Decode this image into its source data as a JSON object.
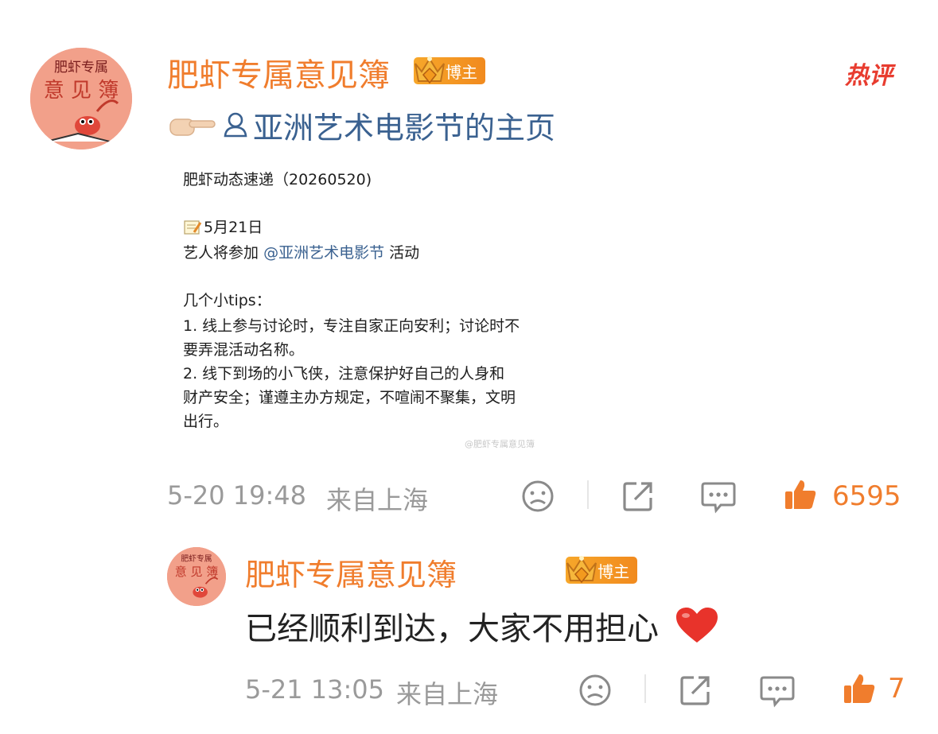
{
  "post": {
    "author": {
      "name": "肥虾专属意见簿",
      "badge_label": "博主",
      "avatar_text_top": "肥虾专属",
      "avatar_text_bottom": "意见簿"
    },
    "hot_label": "热评",
    "mention_text": "亚洲艺术电影节的主页",
    "card": {
      "title": "肥虾动态速递（20260520)",
      "date_line": "5月21日",
      "event_prefix": "艺人将参加",
      "event_mention": "@亚洲艺术电影节",
      "event_suffix": "活动",
      "tips_header": "几个小tips：",
      "tip1_line1": "1. 线上参与讨论时，专注自家正向安利；讨论时不",
      "tip1_line2": "要弄混活动名称。",
      "tip2_line1": "2. 线下到场的小飞侠，注意保护好自己的人身和",
      "tip2_line2": "财产安全；谨遵主办方规定，不喧闹不聚集，文明",
      "tip2_line3": "出行。",
      "watermark": "@肥虾专属意见簿"
    },
    "timestamp": "5-20 19:48",
    "location": "来自上海",
    "like_count": "6595"
  },
  "reply": {
    "author": {
      "name": "肥虾专属意见簿",
      "badge_label": "博主"
    },
    "text": "已经顺利到达，大家不用担心",
    "timestamp": "5-21 13:05",
    "location": "来自上海",
    "like_count": "7"
  },
  "colors": {
    "accent_orange": "#f07d2d",
    "hot_red": "#e83c2f",
    "link_blue": "#3a6190",
    "meta_gray": "#9a9a9a"
  }
}
